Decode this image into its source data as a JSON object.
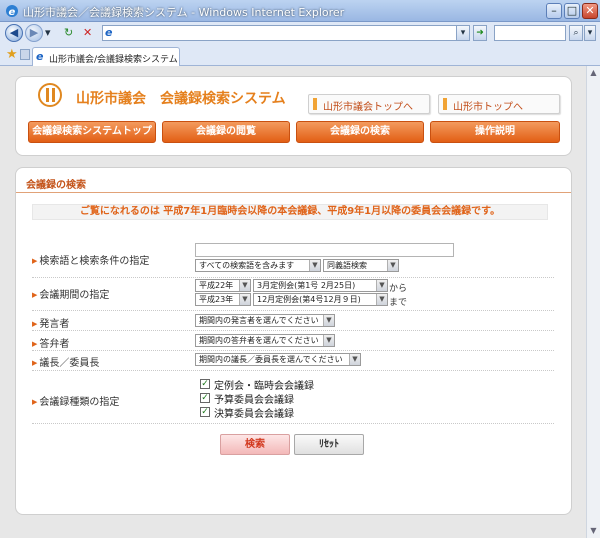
{
  "browser": {
    "window_title": "山形市議会／会議録検索システム - Windows Internet Explorer",
    "tab_title": "山形市議会/会議録検索システム",
    "address_url": ""
  },
  "header": {
    "site_title": "山形市議会　会議録検索システム",
    "top_links": [
      "山形市議会トップへ",
      "山形市トップへ"
    ],
    "nav": [
      "会議録検索システムトップ",
      "会議録の閲覧",
      "会議録の検索",
      "操作説明"
    ]
  },
  "main": {
    "section_title": "会議録の検索",
    "notice": "ご覧になれるのは 平成7年1月臨時会以降の本会議録、平成9年1月以降の委員会会議録です。",
    "keyword": {
      "label": "検索語と検索条件の指定",
      "value": "",
      "condition": "すべての検索語を含みます",
      "synonym": "同義語検索"
    },
    "period": {
      "label": "会議期間の指定",
      "from_year": "平成22年",
      "from_session": "3月定例会(第1号 2月25日)",
      "from_suffix": "から",
      "to_year": "平成23年",
      "to_session": "12月定例会(第4号12月９日)",
      "to_suffix": "まで"
    },
    "speaker": {
      "label": "発言者",
      "value": "期間内の発言者を選んでください"
    },
    "answerer": {
      "label": "答弁者",
      "value": "期間内の答弁者を選んでください"
    },
    "chair": {
      "label": "議長／委員長",
      "value": "期間内の議長／委員長を選んでください"
    },
    "types": {
      "label": "会議録種類の指定",
      "options": [
        {
          "label": "定例会・臨時会会議録",
          "checked": true
        },
        {
          "label": "予算委員会会議録",
          "checked": true
        },
        {
          "label": "決算委員会会議録",
          "checked": true
        }
      ]
    },
    "buttons": {
      "search": "検索",
      "reset": "ﾘｾｯﾄ"
    }
  }
}
